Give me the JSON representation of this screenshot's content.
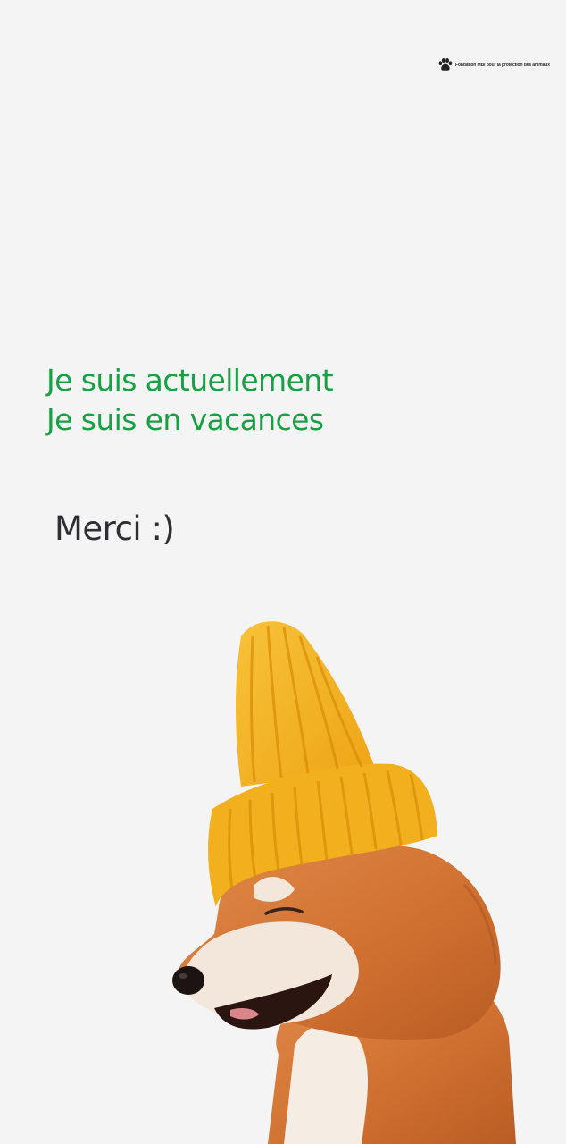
{
  "header": {
    "logo_text": "Fondation MBI pour la protection des animaux",
    "logo_icon": "paw-icon"
  },
  "message": {
    "line1": "Je suis actuellement",
    "line2": "Je suis en vacances",
    "thanks": "Merci :)"
  },
  "illustration": {
    "subject": "shiba-dog-yellow-beanie",
    "colors": {
      "status_text": "#18a142",
      "hat": "#f5b21c",
      "fur": "#d9793a",
      "background": "#f4f4f5"
    }
  }
}
